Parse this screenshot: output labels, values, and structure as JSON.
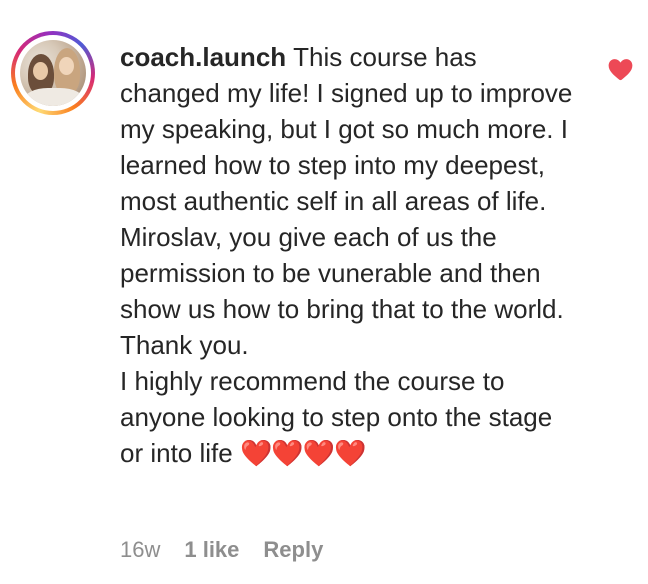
{
  "comment": {
    "username": "coach.launch",
    "lines": [
      "This course has changed my life! I signed up to improve my speaking, but I got so much more. I learned how to step into my deepest, most authentic self in all areas of life.",
      "Miroslav, you give each of us the permission to be vunerable and then show us how to bring that to the world. Thank you.",
      "I highly recommend the course to anyone looking to step onto the stage or into life"
    ],
    "emoji": "❤️❤️❤️❤️"
  },
  "meta": {
    "age": "16w",
    "likes": "1 like",
    "reply_label": "Reply"
  },
  "icons": {
    "like": "heart-icon",
    "avatar": "profile-avatar"
  },
  "colors": {
    "heart": "#ed4956",
    "meta_text": "#8e8e8e",
    "text": "#262626"
  }
}
